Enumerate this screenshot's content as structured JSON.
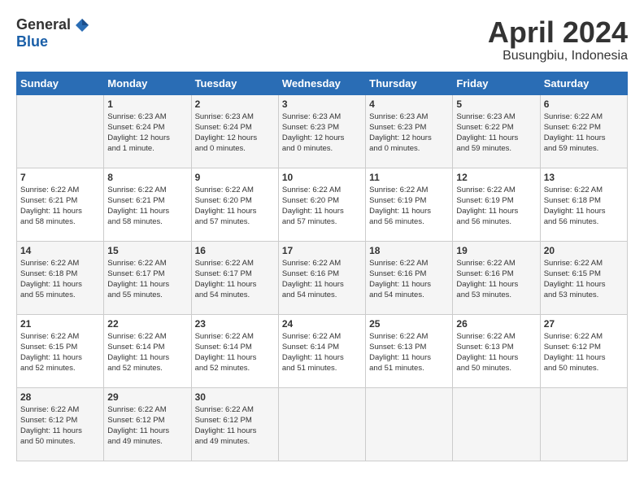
{
  "header": {
    "logo_general": "General",
    "logo_blue": "Blue",
    "month": "April 2024",
    "location": "Busungbiu, Indonesia"
  },
  "days_of_week": [
    "Sunday",
    "Monday",
    "Tuesday",
    "Wednesday",
    "Thursday",
    "Friday",
    "Saturday"
  ],
  "weeks": [
    [
      {
        "day": "",
        "info": ""
      },
      {
        "day": "1",
        "info": "Sunrise: 6:23 AM\nSunset: 6:24 PM\nDaylight: 12 hours\nand 1 minute."
      },
      {
        "day": "2",
        "info": "Sunrise: 6:23 AM\nSunset: 6:24 PM\nDaylight: 12 hours\nand 0 minutes."
      },
      {
        "day": "3",
        "info": "Sunrise: 6:23 AM\nSunset: 6:23 PM\nDaylight: 12 hours\nand 0 minutes."
      },
      {
        "day": "4",
        "info": "Sunrise: 6:23 AM\nSunset: 6:23 PM\nDaylight: 12 hours\nand 0 minutes."
      },
      {
        "day": "5",
        "info": "Sunrise: 6:23 AM\nSunset: 6:22 PM\nDaylight: 11 hours\nand 59 minutes."
      },
      {
        "day": "6",
        "info": "Sunrise: 6:22 AM\nSunset: 6:22 PM\nDaylight: 11 hours\nand 59 minutes."
      }
    ],
    [
      {
        "day": "7",
        "info": "Sunrise: 6:22 AM\nSunset: 6:21 PM\nDaylight: 11 hours\nand 58 minutes."
      },
      {
        "day": "8",
        "info": "Sunrise: 6:22 AM\nSunset: 6:21 PM\nDaylight: 11 hours\nand 58 minutes."
      },
      {
        "day": "9",
        "info": "Sunrise: 6:22 AM\nSunset: 6:20 PM\nDaylight: 11 hours\nand 57 minutes."
      },
      {
        "day": "10",
        "info": "Sunrise: 6:22 AM\nSunset: 6:20 PM\nDaylight: 11 hours\nand 57 minutes."
      },
      {
        "day": "11",
        "info": "Sunrise: 6:22 AM\nSunset: 6:19 PM\nDaylight: 11 hours\nand 56 minutes."
      },
      {
        "day": "12",
        "info": "Sunrise: 6:22 AM\nSunset: 6:19 PM\nDaylight: 11 hours\nand 56 minutes."
      },
      {
        "day": "13",
        "info": "Sunrise: 6:22 AM\nSunset: 6:18 PM\nDaylight: 11 hours\nand 56 minutes."
      }
    ],
    [
      {
        "day": "14",
        "info": "Sunrise: 6:22 AM\nSunset: 6:18 PM\nDaylight: 11 hours\nand 55 minutes."
      },
      {
        "day": "15",
        "info": "Sunrise: 6:22 AM\nSunset: 6:17 PM\nDaylight: 11 hours\nand 55 minutes."
      },
      {
        "day": "16",
        "info": "Sunrise: 6:22 AM\nSunset: 6:17 PM\nDaylight: 11 hours\nand 54 minutes."
      },
      {
        "day": "17",
        "info": "Sunrise: 6:22 AM\nSunset: 6:16 PM\nDaylight: 11 hours\nand 54 minutes."
      },
      {
        "day": "18",
        "info": "Sunrise: 6:22 AM\nSunset: 6:16 PM\nDaylight: 11 hours\nand 54 minutes."
      },
      {
        "day": "19",
        "info": "Sunrise: 6:22 AM\nSunset: 6:16 PM\nDaylight: 11 hours\nand 53 minutes."
      },
      {
        "day": "20",
        "info": "Sunrise: 6:22 AM\nSunset: 6:15 PM\nDaylight: 11 hours\nand 53 minutes."
      }
    ],
    [
      {
        "day": "21",
        "info": "Sunrise: 6:22 AM\nSunset: 6:15 PM\nDaylight: 11 hours\nand 52 minutes."
      },
      {
        "day": "22",
        "info": "Sunrise: 6:22 AM\nSunset: 6:14 PM\nDaylight: 11 hours\nand 52 minutes."
      },
      {
        "day": "23",
        "info": "Sunrise: 6:22 AM\nSunset: 6:14 PM\nDaylight: 11 hours\nand 52 minutes."
      },
      {
        "day": "24",
        "info": "Sunrise: 6:22 AM\nSunset: 6:14 PM\nDaylight: 11 hours\nand 51 minutes."
      },
      {
        "day": "25",
        "info": "Sunrise: 6:22 AM\nSunset: 6:13 PM\nDaylight: 11 hours\nand 51 minutes."
      },
      {
        "day": "26",
        "info": "Sunrise: 6:22 AM\nSunset: 6:13 PM\nDaylight: 11 hours\nand 50 minutes."
      },
      {
        "day": "27",
        "info": "Sunrise: 6:22 AM\nSunset: 6:12 PM\nDaylight: 11 hours\nand 50 minutes."
      }
    ],
    [
      {
        "day": "28",
        "info": "Sunrise: 6:22 AM\nSunset: 6:12 PM\nDaylight: 11 hours\nand 50 minutes."
      },
      {
        "day": "29",
        "info": "Sunrise: 6:22 AM\nSunset: 6:12 PM\nDaylight: 11 hours\nand 49 minutes."
      },
      {
        "day": "30",
        "info": "Sunrise: 6:22 AM\nSunset: 6:12 PM\nDaylight: 11 hours\nand 49 minutes."
      },
      {
        "day": "",
        "info": ""
      },
      {
        "day": "",
        "info": ""
      },
      {
        "day": "",
        "info": ""
      },
      {
        "day": "",
        "info": ""
      }
    ]
  ]
}
